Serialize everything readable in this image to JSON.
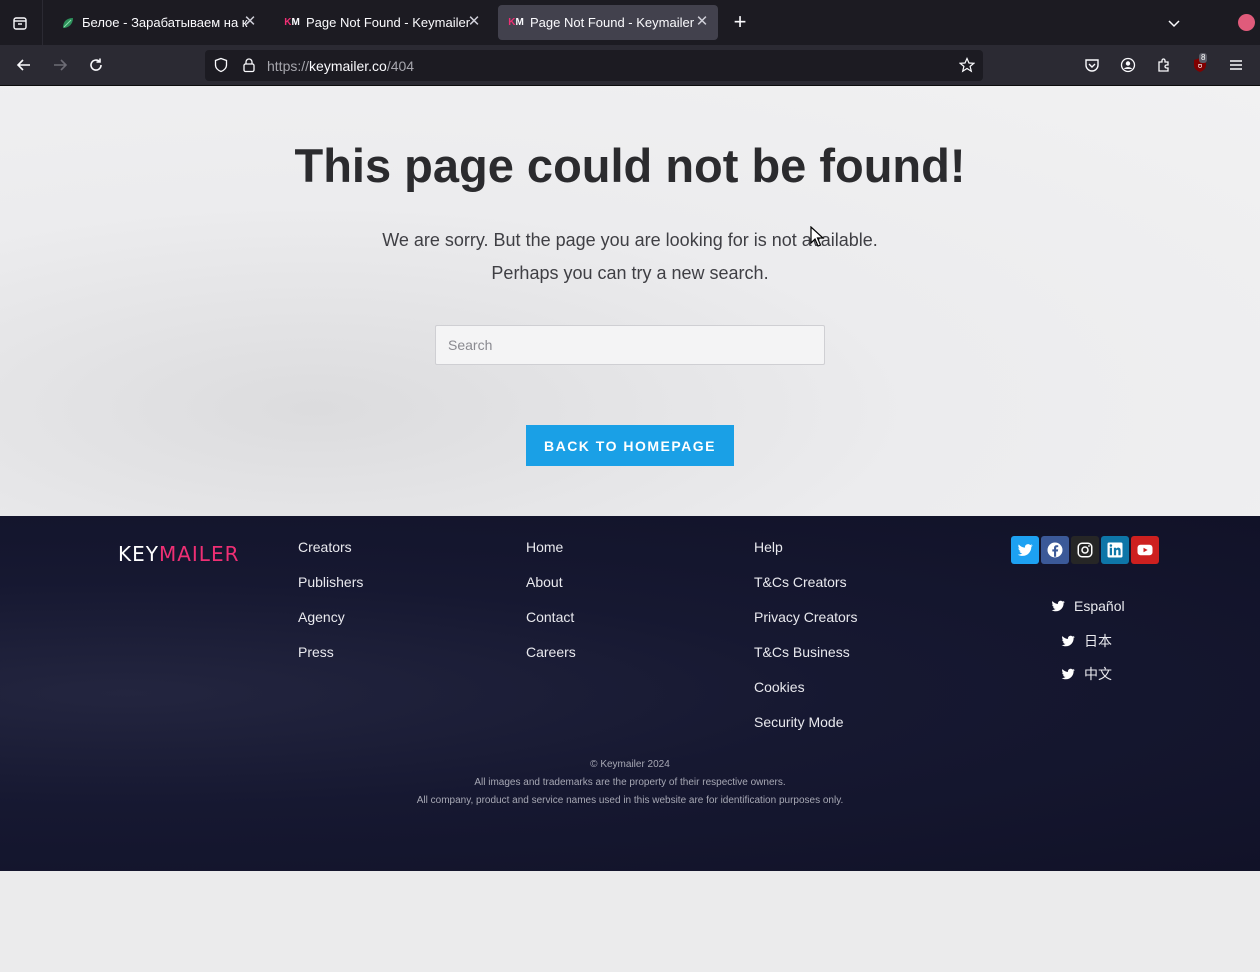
{
  "browser": {
    "tabs": [
      {
        "title": "Белое - Зарабатываем на к",
        "active": false
      },
      {
        "title": "Page Not Found - Keymailer",
        "active": false
      },
      {
        "title": "Page Not Found - Keymailer",
        "active": true
      }
    ],
    "url_host": "keymailer.co",
    "url_scheme": "https://",
    "url_path": "/404",
    "extension_badge": "8",
    "favicon_text": "KM"
  },
  "content": {
    "title": "This page could not be found!",
    "sorry": "We are sorry. But the page you are looking for is not available.",
    "perhaps": "Perhaps you can try a new search.",
    "search_placeholder": "Search",
    "home_button": "BACK TO HOMEPAGE"
  },
  "footer": {
    "logo_key": "KEY",
    "logo_mailer": "MAILER",
    "col1": [
      "Creators",
      "Publishers",
      "Agency",
      "Press"
    ],
    "col2": [
      "Home",
      "About",
      "Contact",
      "Careers"
    ],
    "col3": [
      "Help",
      "T&Cs Creators",
      "Privacy Creators",
      "T&Cs Business",
      "Cookies",
      "Security Mode"
    ],
    "socials": [
      {
        "name": "twitter-icon",
        "color": "#1da1f2"
      },
      {
        "name": "facebook-icon",
        "color": "#3b5998"
      },
      {
        "name": "instagram-icon",
        "color": "#262626"
      },
      {
        "name": "linkedin-icon",
        "color": "#0e76a8"
      },
      {
        "name": "youtube-icon",
        "color": "#cd201f"
      }
    ],
    "languages": [
      "Español",
      "日本",
      "中文"
    ],
    "copyright": "© Keymailer 2024",
    "disclaimer1": "All images and trademarks are the property of their respective owners.",
    "disclaimer2": "All company, product and service names used in this website are for identification purposes only."
  },
  "colors": {
    "accent": "#1aa0e6",
    "brand_pink": "#ef2f74",
    "footer_bg": "#161831"
  }
}
